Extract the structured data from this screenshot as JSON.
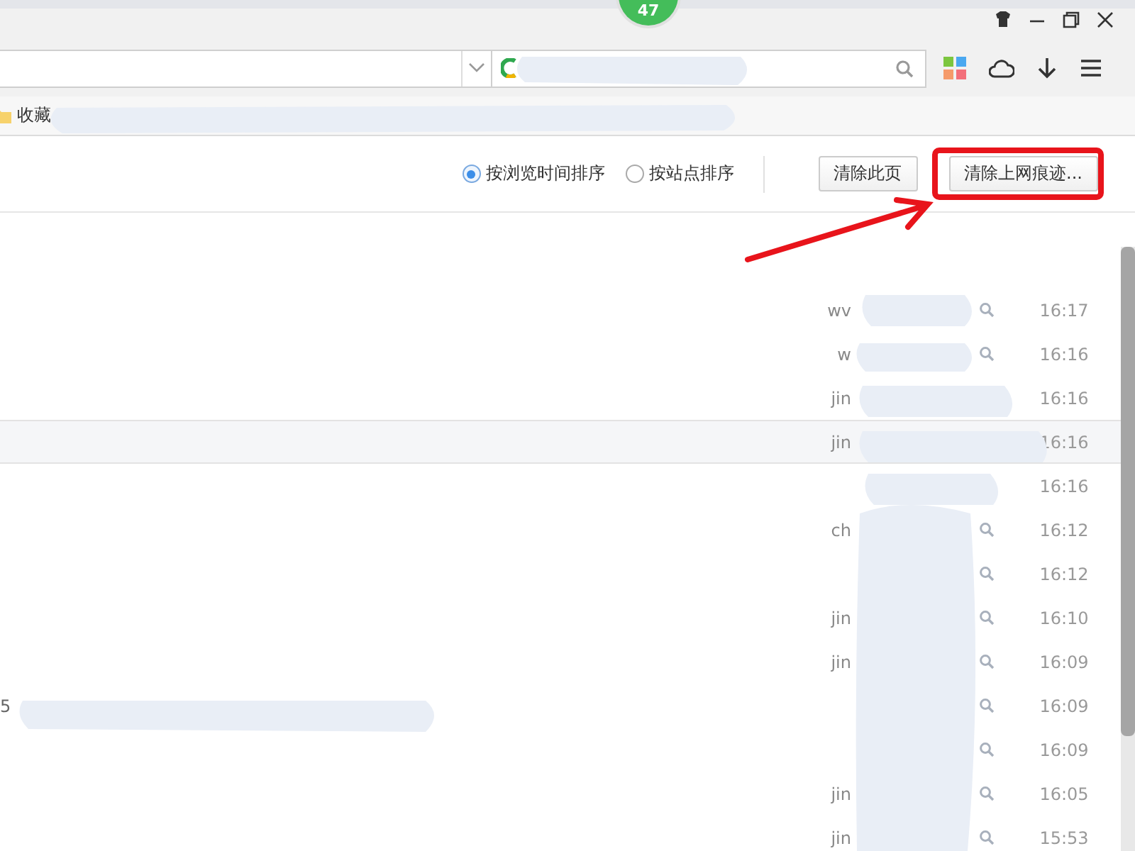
{
  "title_bar": {
    "badge": "47"
  },
  "bookmarks_bar": {
    "items": [
      {
        "label": "收藏"
      }
    ]
  },
  "toolbar": {
    "sort_options": [
      {
        "label": "按浏览时间排序",
        "selected": true
      },
      {
        "label": "按站点排序",
        "selected": false
      }
    ],
    "buttons": [
      {
        "label": "清除此页",
        "highlighted": false
      },
      {
        "label": "清除上网痕迹...",
        "highlighted": true
      }
    ]
  },
  "history": [
    {
      "domain": "wv",
      "search": true,
      "time": "16:17",
      "selected": false
    },
    {
      "domain": "w",
      "search": true,
      "time": "16:16",
      "selected": false
    },
    {
      "domain": "jin",
      "time": "16:16",
      "selected": false
    },
    {
      "domain": "jin",
      "time": "16:16",
      "selected": true
    },
    {
      "time": "16:16",
      "selected": false
    },
    {
      "domain": "ch",
      "search": true,
      "time": "16:12",
      "selected": false
    },
    {
      "search": true,
      "time": "16:12",
      "selected": false
    },
    {
      "domain": "jin",
      "search": true,
      "time": "16:10",
      "selected": false
    },
    {
      "domain": "jin",
      "search": true,
      "time": "16:09",
      "selected": false
    },
    {
      "title": "5",
      "search": true,
      "time": "16:09",
      "selected": false
    },
    {
      "search": true,
      "time": "16:09",
      "selected": false
    },
    {
      "domain": "jin",
      "search": true,
      "time": "16:05",
      "selected": false
    },
    {
      "domain": "jin",
      "search": true,
      "time": "15:53",
      "selected": false
    }
  ]
}
